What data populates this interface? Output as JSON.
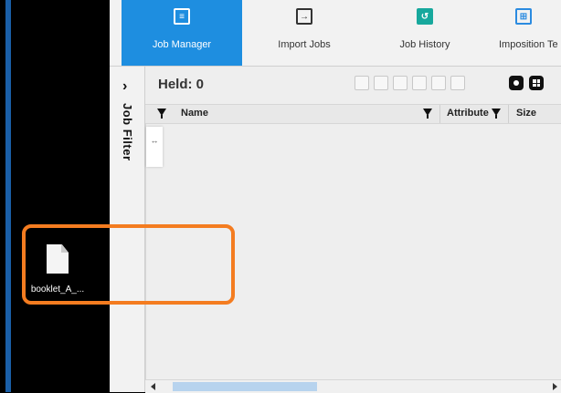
{
  "desktop": {
    "file_icon": "document-icon",
    "file_label": "booklet_A_..."
  },
  "toolbar": {
    "tabs": [
      {
        "label": "Job Manager",
        "icon": "job-manager-icon",
        "active": true
      },
      {
        "label": "Import Jobs",
        "icon": "import-icon",
        "active": false
      },
      {
        "label": "Job History",
        "icon": "history-icon",
        "active": false
      },
      {
        "label": "Imposition Te",
        "icon": "imposition-icon",
        "active": false
      }
    ]
  },
  "filter": {
    "chevron": "›",
    "label": "Job Filter"
  },
  "jobs": {
    "held_label": "Held: 0",
    "toolbar_icons": [
      "play-icon",
      "print-icon",
      "copy-icon",
      "preview-icon",
      "delete-icon",
      "list-icon",
      "settings-icon",
      "grid-icon"
    ],
    "columns": [
      "Name",
      "Attribute",
      "Size"
    ]
  },
  "cursor_hint": "↔",
  "colors": {
    "accent": "#1e8ee0",
    "highlight": "#f47c20",
    "history_icon": "#17a89d"
  }
}
